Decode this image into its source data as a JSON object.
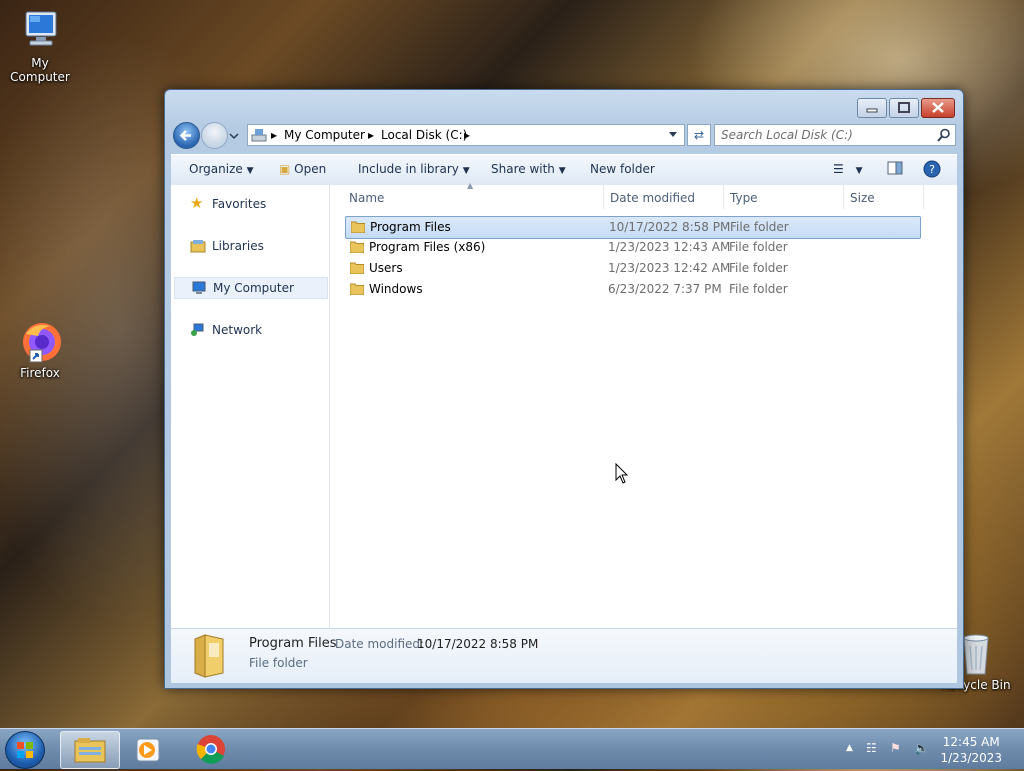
{
  "desktop": {
    "icons": [
      {
        "label": "My Computer"
      },
      {
        "label": "Firefox"
      },
      {
        "label": "Recycle Bin"
      }
    ]
  },
  "window": {
    "address": {
      "crumbs": [
        "My Computer",
        "Local Disk (C:)"
      ]
    },
    "search": {
      "placeholder": "Search Local Disk (C:)"
    },
    "toolbar": {
      "organize": "Organize",
      "open": "Open",
      "include_in_library": "Include in library",
      "share_with": "Share with",
      "new_folder": "New folder"
    },
    "nav_pane": [
      {
        "label": "Favorites",
        "icon": "star-icon"
      },
      {
        "label": "Libraries",
        "icon": "libraries-icon"
      },
      {
        "label": "My Computer",
        "icon": "computer-icon",
        "selected": true
      },
      {
        "label": "Network",
        "icon": "network-icon"
      }
    ],
    "columns": [
      "Name",
      "Date modified",
      "Type",
      "Size"
    ],
    "rows": [
      {
        "name": "Program Files",
        "date": "10/17/2022 8:58 PM",
        "type": "File folder",
        "selected": true
      },
      {
        "name": "Program Files (x86)",
        "date": "1/23/2023 12:43 AM",
        "type": "File folder"
      },
      {
        "name": "Users",
        "date": "1/23/2023 12:42 AM",
        "type": "File folder"
      },
      {
        "name": "Windows",
        "date": "6/23/2022 7:37 PM",
        "type": "File folder"
      }
    ],
    "details": {
      "name": "Program Files",
      "date_label": "Date modified:",
      "date_value": "10/17/2022 8:58 PM",
      "type": "File folder"
    }
  },
  "taskbar": {
    "time": "12:45 AM",
    "date": "1/23/2023"
  },
  "colors": {
    "selection": "#cce8ff",
    "accent": "#1e3250",
    "folder": "#e8c45a"
  }
}
